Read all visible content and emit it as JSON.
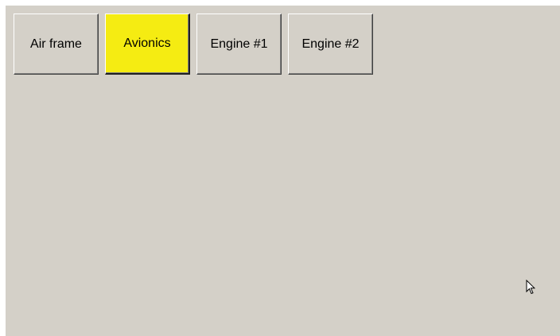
{
  "tabs": [
    {
      "label": "Air frame",
      "active": false
    },
    {
      "label": "Avionics",
      "active": true
    },
    {
      "label": "Engine #1",
      "active": false
    },
    {
      "label": "Engine #2",
      "active": false
    }
  ],
  "colors": {
    "panel": "#d4d0c8",
    "active_tab": "#f5ec12"
  },
  "icons": {
    "cursor": "mouse-pointer-icon"
  }
}
